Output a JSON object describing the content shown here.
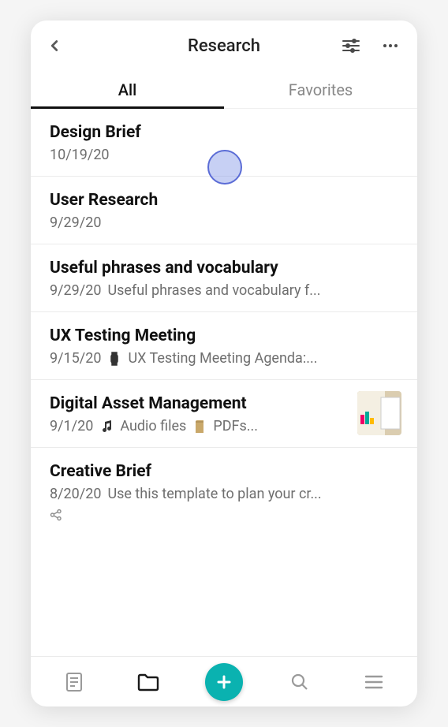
{
  "header": {
    "title": "Research"
  },
  "tabs": {
    "items": [
      {
        "label": "All",
        "active": true
      },
      {
        "label": "Favorites",
        "active": false
      }
    ]
  },
  "notes": [
    {
      "title": "Design Brief",
      "date": "10/19/20",
      "snippet": "",
      "icons": [],
      "thumb": false,
      "share": false
    },
    {
      "title": "User Research",
      "date": "9/29/20",
      "snippet": "",
      "icons": [],
      "thumb": false,
      "share": false
    },
    {
      "title": "Useful phrases and vocabulary",
      "date": "9/29/20",
      "snippet": "Useful phrases and vocabulary f...",
      "icons": [],
      "thumb": false,
      "share": false
    },
    {
      "title": "UX Testing Meeting",
      "date": "9/15/20",
      "snippet": "UX Testing Meeting Agenda:...",
      "icons": [
        "watch-icon"
      ],
      "thumb": false,
      "share": false
    },
    {
      "title": "Digital Asset Management",
      "date": "9/1/20",
      "snippet": "Audio files",
      "snippet2": "PDFs...",
      "icons": [
        "music-note-icon",
        "attachment-icon"
      ],
      "thumb": true,
      "share": false
    },
    {
      "title": "Creative Brief",
      "date": "8/20/20",
      "snippet": "Use this template to plan your cr...",
      "icons": [],
      "thumb": false,
      "share": true
    }
  ],
  "colors": {
    "accent": "#0ab2b0",
    "tap_indicator_fill": "rgba(130,150,230,0.45)",
    "tap_indicator_border": "#5b6cd6"
  }
}
